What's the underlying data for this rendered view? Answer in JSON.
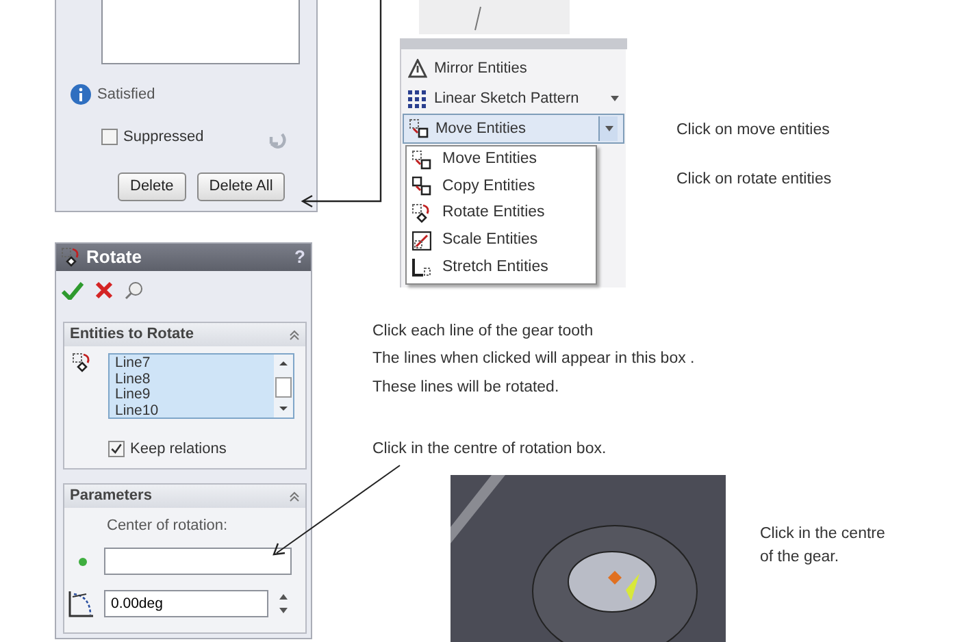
{
  "relations_panel": {
    "status": "Satisfied",
    "suppressed": {
      "label": "Suppressed",
      "checked": false
    },
    "buttons": [
      "Delete",
      "Delete All"
    ]
  },
  "menu": {
    "items": [
      {
        "label": "Mirror Entities",
        "kind": "plain",
        "selected": false
      },
      {
        "label": "Linear Sketch Pattern",
        "kind": "dropdown",
        "selected": false
      },
      {
        "label": "Move Entities",
        "kind": "split",
        "selected": true
      }
    ],
    "submenu": [
      "Move Entities",
      "Copy Entities",
      "Rotate Entities",
      "Scale Entities",
      "Stretch Entities"
    ]
  },
  "menu_notes": [
    "Click on move entities",
    "Click on rotate entities"
  ],
  "rotate_panel": {
    "title": "Rotate",
    "help": "?",
    "entities_section": {
      "title": "Entities to Rotate",
      "expanded": true,
      "items": [
        "Line7",
        "Line8",
        "Line9",
        "Line10"
      ],
      "keep_relations": {
        "label": "Keep relations",
        "checked": true
      }
    },
    "parameters_section": {
      "title": "Parameters",
      "expanded": true,
      "center_label": "Center of rotation:",
      "angle": "0.00deg"
    }
  },
  "entities_note": [
    "Click each line of the gear tooth",
    "The lines when clicked will appear in this box .",
    "These lines will be rotated."
  ],
  "rotation_box_note": "Click in the centre of rotation box.",
  "gear_note": "Click in the centre of the gear."
}
